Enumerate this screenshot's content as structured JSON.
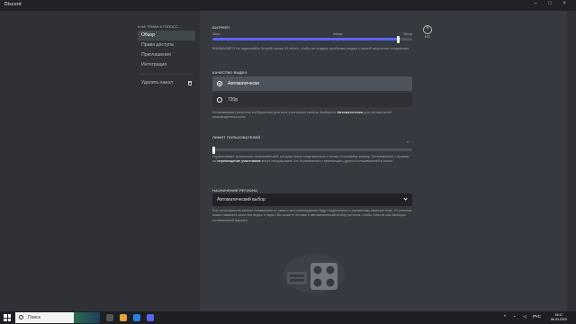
{
  "window": {
    "title": "Discord"
  },
  "sidebar": {
    "breadcrumb": "# НА ТРИАН   # ГОЛОСС...",
    "items": [
      {
        "label": "Обзор",
        "active": true
      },
      {
        "label": "Права доступа",
        "active": false
      },
      {
        "label": "Приглашения",
        "active": false
      },
      {
        "label": "Интеграция",
        "active": false
      }
    ],
    "delete_label": "Удалить канал"
  },
  "bitrate": {
    "label": "БИТРЕЙТ",
    "min_label": "8kbps",
    "mid_label": "64kbps",
    "max_label": "96kbps",
    "value_fraction": 0.93,
    "mid_fraction": 0.9,
    "warning": "ВНИМАНИЕ!!! Не поднимайте битрейт выше 64 кбит/с, чтобы не создать проблемы людям с низкой скоростью соединения."
  },
  "video_quality": {
    "label": "КАЧЕСТВО ВИДЕО",
    "options": [
      {
        "label": "Автоматически",
        "selected": true
      },
      {
        "label": "720p",
        "selected": false
      }
    ],
    "description_prefix": "Устанавливает качество изображения для всех участников канала. Выберите ",
    "description_bold": "Автоматически",
    "description_suffix": " для оптимальной производительности."
  },
  "user_limit": {
    "label": "ЛИМИТ ПОЛЬЗОВАТЕЛЕЙ",
    "max_label": "∞",
    "value_fraction": 0,
    "description_1": "Ограничивает количество пользователей, которые могут подключиться к этому голосовому каналу. Пользователи с правом на ",
    "description_bold": "перемещение участников",
    "description_2": " могут игнорировать это ограничение и перемещать других пользователей в канал."
  },
  "region": {
    "label": "НАЗНАЧЕНИЕ РЕГИОНА",
    "selected": "Автоматический выбор",
    "description": "Все пользователи канала независимо от своего местонахождения будут подключены к указанному вами региону. От региона может зависеть качество видео и звука. Вы можете оставить автоматический выбор региона, чтобы Discord сам выбирал оптимальный вариант."
  },
  "esc": {
    "label": "ESC"
  },
  "taskbar": {
    "search_placeholder": "Поиск",
    "tray_lang": "РУС",
    "time": "16:17",
    "date": "06.03.2023"
  },
  "colors": {
    "accent": "#5865f2",
    "sidebar": "#2f3136",
    "main": "#36393f"
  }
}
